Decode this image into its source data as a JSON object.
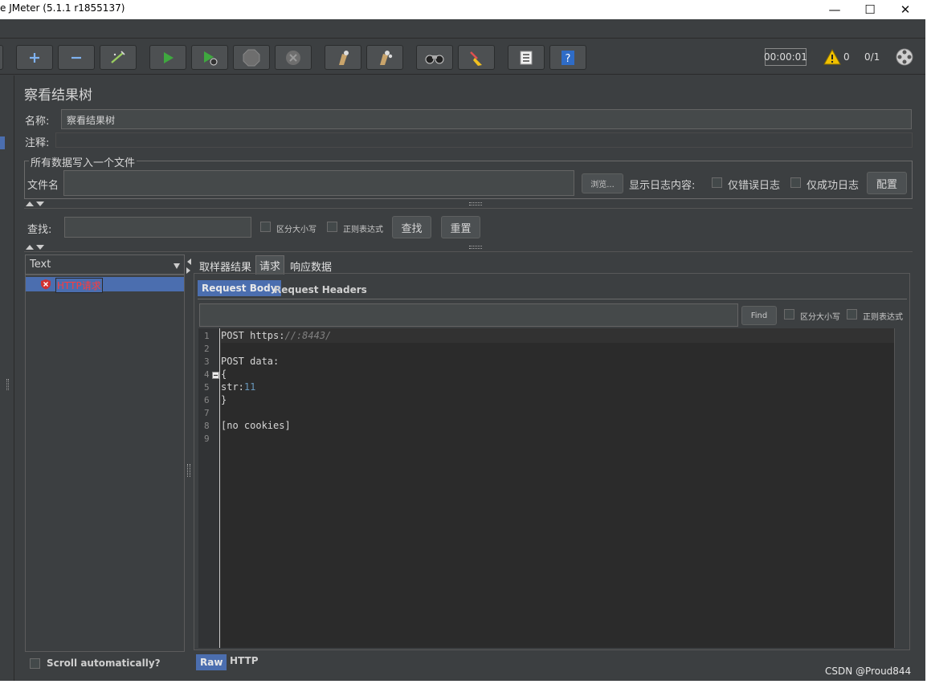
{
  "window": {
    "title": "e JMeter (5.1.1 r1855137)",
    "minimize": "—",
    "maximize": "☐",
    "close": "✕"
  },
  "toolbar": {
    "timer": "00:00:01",
    "warning_count": "0",
    "threads": "0/1",
    "buttons": [
      "add",
      "remove",
      "toggle",
      "start",
      "start-no-pause",
      "stop",
      "shutdown",
      "clear",
      "clear-all",
      "search",
      "reset-search",
      "function-helper",
      "help"
    ]
  },
  "panel": {
    "title": "察看结果树",
    "name_label": "名称:",
    "name_value": "察看结果树",
    "comment_label": "注释:",
    "comment_value": "",
    "file_group_title": "所有数据写入一个文件",
    "filename_label": "文件名",
    "filename_value": "",
    "browse_button": "浏览...",
    "log_content_label": "显示日志内容:",
    "errors_only": "仅错误日志",
    "success_only": "仅成功日志",
    "configure_button": "配置"
  },
  "search": {
    "label": "查找:",
    "value": "",
    "case_sensitive": "区分大小写",
    "regex": "正则表达式",
    "find_button": "查找",
    "reset_button": "重置"
  },
  "tree": {
    "renderer": "Text",
    "items": [
      {
        "label": "HTTP请求",
        "status": "error"
      }
    ],
    "scroll_auto": "Scroll automatically?"
  },
  "result_tabs": [
    "取样器结果",
    "请求",
    "响应数据"
  ],
  "active_result_tab": "请求",
  "request_tabs": [
    "Request Body",
    "Request Headers"
  ],
  "active_request_tab": "Request Body",
  "body_search": {
    "value": "",
    "find_button": "Find",
    "case_sensitive": "区分大小写",
    "regex": "正则表达式"
  },
  "code": {
    "line_numbers": [
      "1",
      "2",
      "3",
      "4",
      "5",
      "6",
      "7",
      "8",
      "9"
    ],
    "line1_a": "POST https:",
    "line1_b": "//:8443/",
    "line3": "POST data:",
    "line4": "{",
    "line5_a": "str:",
    "line5_b": "11",
    "line6": "}",
    "line8": "[no cookies]"
  },
  "view_tabs": [
    "Raw",
    "HTTP"
  ],
  "active_view_tab": "Raw",
  "watermark": "CSDN @Proud844"
}
